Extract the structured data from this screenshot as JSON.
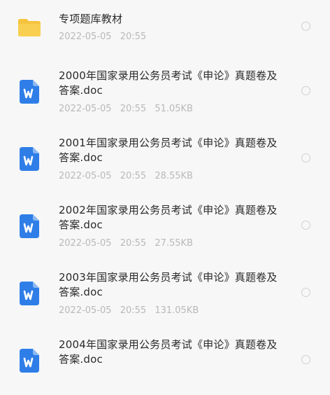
{
  "items": [
    {
      "type": "folder",
      "icon": "folder-icon",
      "name": "专项题库教材",
      "date": "2022-05-05",
      "time": "20:55",
      "size": ""
    },
    {
      "type": "doc",
      "icon": "word-doc-icon",
      "name": "2000年国家录用公务员考试《申论》真题卷及答案.doc",
      "date": "2022-05-05",
      "time": "20:55",
      "size": "51.05KB"
    },
    {
      "type": "doc",
      "icon": "word-doc-icon",
      "name": "2001年国家录用公务员考试《申论》真题卷及答案.doc",
      "date": "2022-05-05",
      "time": "20:55",
      "size": "28.55KB"
    },
    {
      "type": "doc",
      "icon": "word-doc-icon",
      "name": "2002年国家录用公务员考试《申论》真题卷及答案.doc",
      "date": "2022-05-05",
      "time": "20:55",
      "size": "27.55KB"
    },
    {
      "type": "doc",
      "icon": "word-doc-icon",
      "name": "2003年国家录用公务员考试《申论》真题卷及答案.doc",
      "date": "2022-05-05",
      "time": "20:55",
      "size": "131.05KB"
    },
    {
      "type": "doc",
      "icon": "word-doc-icon",
      "name": "2004年国家录用公务员考试《申论》真题卷及答案.doc",
      "date": "",
      "time": "",
      "size": ""
    }
  ],
  "colors": {
    "background": "#f7f7f7",
    "folder": "#f6c33d",
    "word_blue": "#2f7ee8",
    "title_text": "#2a2a2a",
    "meta_text": "#b9b9b9"
  }
}
